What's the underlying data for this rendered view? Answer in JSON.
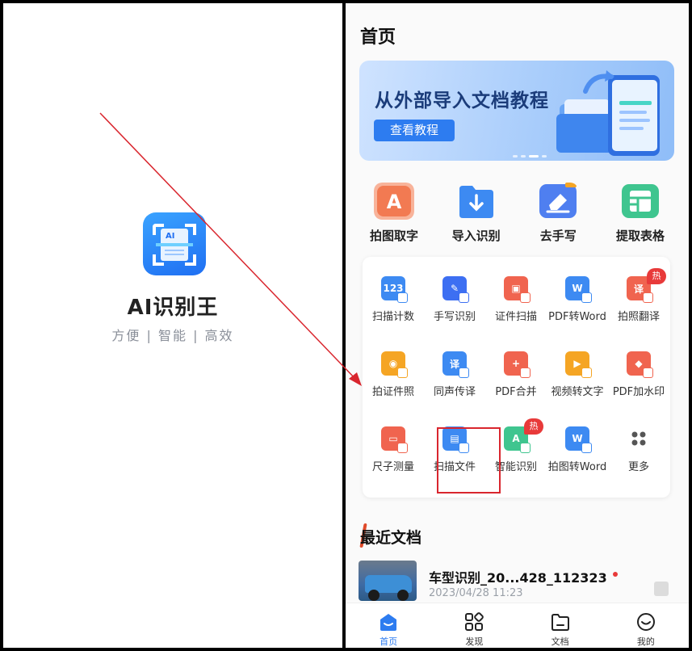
{
  "splash": {
    "app_name": "AI识别王",
    "slogan": "方便 | 智能 | 高效",
    "logo_text": "AI"
  },
  "home": {
    "title": "首页",
    "banner": {
      "title": "从外部导入文档教程",
      "button": "查看教程"
    },
    "main_tools": [
      {
        "label": "拍图取字",
        "icon": "letter-a-icon",
        "color": "#f27a52"
      },
      {
        "label": "导入识别",
        "icon": "folder-import-icon",
        "color": "#3d8af2"
      },
      {
        "label": "去手写",
        "icon": "eraser-icon",
        "color": "#4f7ff0"
      },
      {
        "label": "提取表格",
        "icon": "table-icon",
        "color": "#3fc58f"
      }
    ],
    "tools": [
      {
        "label": "扫描计数",
        "icon": "scan-count-icon",
        "color": "#3d8af2"
      },
      {
        "label": "手写识别",
        "icon": "handwriting-icon",
        "color": "#3d6ff2"
      },
      {
        "label": "证件扫描",
        "icon": "id-scan-icon",
        "color": "#f0644f"
      },
      {
        "label": "PDF转Word",
        "icon": "pdf-word-icon",
        "color": "#3d8af2"
      },
      {
        "label": "拍照翻译",
        "icon": "photo-translate-icon",
        "color": "#f0644f",
        "badge": "热"
      },
      {
        "label": "拍证件照",
        "icon": "id-photo-icon",
        "color": "#f5a524"
      },
      {
        "label": "同声传译",
        "icon": "interpret-icon",
        "color": "#3d8af2"
      },
      {
        "label": "PDF合并",
        "icon": "pdf-merge-icon",
        "color": "#f0644f"
      },
      {
        "label": "视频转文字",
        "icon": "video-text-icon",
        "color": "#f5a524"
      },
      {
        "label": "PDF加水印",
        "icon": "pdf-watermark-icon",
        "color": "#f0644f"
      },
      {
        "label": "尺子测量",
        "icon": "ruler-icon",
        "color": "#f0644f"
      },
      {
        "label": "扫描文件",
        "icon": "scan-file-icon",
        "color": "#3d8af2"
      },
      {
        "label": "智能识别",
        "icon": "smart-recognize-icon",
        "color": "#3fc58f",
        "badge": "热"
      },
      {
        "label": "拍图转Word",
        "icon": "photo-word-icon",
        "color": "#3d8af2"
      },
      {
        "label": "更多",
        "icon": "more-grid-icon",
        "color": "#555555"
      }
    ],
    "recent": {
      "title": "最近文档",
      "documents": [
        {
          "name": "车型识别_20...428_112323",
          "date": "2023/04/28 11:23"
        }
      ]
    },
    "tabbar": [
      {
        "label": "首页",
        "icon": "home-icon",
        "active": true
      },
      {
        "label": "发现",
        "icon": "discover-grid-icon",
        "active": false
      },
      {
        "label": "文档",
        "icon": "folder-icon",
        "active": false
      },
      {
        "label": "我的",
        "icon": "profile-smile-icon",
        "active": false
      }
    ]
  },
  "colors": {
    "accent": "#2d7cf0",
    "annotation_red": "#d9262e",
    "hot_badge": "#e83a3a"
  }
}
